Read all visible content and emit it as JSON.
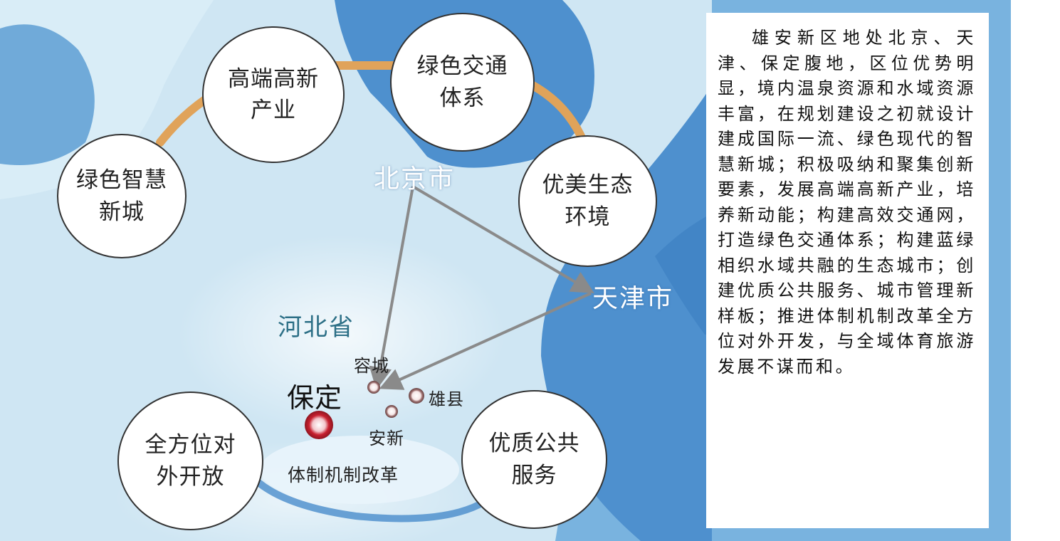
{
  "map": {
    "bubbles": [
      {
        "id": "smart-city",
        "lines": [
          "绿色智慧",
          "新城"
        ]
      },
      {
        "id": "high-tech",
        "lines": [
          "高端高新",
          "产业"
        ]
      },
      {
        "id": "green-transport",
        "lines": [
          "绿色交通",
          "体系"
        ]
      },
      {
        "id": "ecology",
        "lines": [
          "优美生态",
          "环境"
        ]
      },
      {
        "id": "opening",
        "lines": [
          "全方位对",
          "外开放"
        ]
      },
      {
        "id": "public-service",
        "lines": [
          "优质公共",
          "服务"
        ]
      }
    ],
    "places": {
      "beijing": "北京市",
      "tianjin": "天津市",
      "hebei": "河北省",
      "baoding": "保定",
      "rongcheng": "容城",
      "xiongxian": "雄县",
      "anxin": "安新"
    },
    "center_label": "体制机制改革",
    "colors": {
      "sea": "#79b3df",
      "land": "#cfe6f3",
      "city_region": "#4e90ce",
      "arc": "#e0a35a",
      "lower_ring": "#3f86c8",
      "arrow": "#8a8a8a",
      "baoding_marker": "#c8202f"
    }
  },
  "panel": {
    "text": "雄安新区地处北京、天津、保定腹地，区位优势明显，境内温泉资源和水域资源丰富，在规划建设之初就设计建成国际一流、绿色现代的智慧新城；积极吸纳和聚集创新要素，发展高端高新产业，培养新动能；构建高效交通网，打造绿色交通体系；构建蓝绿相织水域共融的生态城市；创建优质公共服务、城市管理新样板；推进体制机制改革全方位对外开发，与全域体育旅游发展不谋而和。"
  }
}
